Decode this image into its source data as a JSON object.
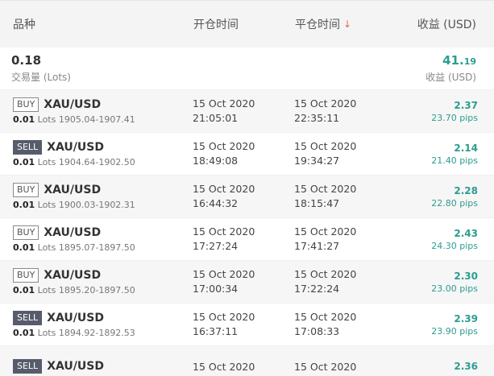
{
  "header": {
    "instrument": "品种",
    "open_time": "开仓时间",
    "close_time": "平仓时间",
    "sort_arrow": "↓",
    "profit": "收益 (USD)"
  },
  "summary": {
    "lots_value": "0.18",
    "lots_label": "交易量 (Lots)",
    "profit_main": "41.",
    "profit_dec": "19",
    "profit_label": "收益 (USD)"
  },
  "trades": [
    {
      "side": "BUY",
      "symbol": "XAU/USD",
      "lots": "0.01",
      "lots_label": "Lots",
      "range": "1905.04-1907.41",
      "open_date": "15 Oct 2020",
      "open_time": "21:05:01",
      "close_date": "15 Oct 2020",
      "close_time": "22:35:11",
      "profit": "2.37",
      "pips": "23.70 pips"
    },
    {
      "side": "SELL",
      "symbol": "XAU/USD",
      "lots": "0.01",
      "lots_label": "Lots",
      "range": "1904.64-1902.50",
      "open_date": "15 Oct 2020",
      "open_time": "18:49:08",
      "close_date": "15 Oct 2020",
      "close_time": "19:34:27",
      "profit": "2.14",
      "pips": "21.40 pips"
    },
    {
      "side": "BUY",
      "symbol": "XAU/USD",
      "lots": "0.01",
      "lots_label": "Lots",
      "range": "1900.03-1902.31",
      "open_date": "15 Oct 2020",
      "open_time": "16:44:32",
      "close_date": "15 Oct 2020",
      "close_time": "18:15:47",
      "profit": "2.28",
      "pips": "22.80 pips"
    },
    {
      "side": "BUY",
      "symbol": "XAU/USD",
      "lots": "0.01",
      "lots_label": "Lots",
      "range": "1895.07-1897.50",
      "open_date": "15 Oct 2020",
      "open_time": "17:27:24",
      "close_date": "15 Oct 2020",
      "close_time": "17:41:27",
      "profit": "2.43",
      "pips": "24.30 pips"
    },
    {
      "side": "BUY",
      "symbol": "XAU/USD",
      "lots": "0.01",
      "lots_label": "Lots",
      "range": "1895.20-1897.50",
      "open_date": "15 Oct 2020",
      "open_time": "17:00:34",
      "close_date": "15 Oct 2020",
      "close_time": "17:22:24",
      "profit": "2.30",
      "pips": "23.00 pips"
    },
    {
      "side": "SELL",
      "symbol": "XAU/USD",
      "lots": "0.01",
      "lots_label": "Lots",
      "range": "1894.92-1892.53",
      "open_date": "15 Oct 2020",
      "open_time": "16:37:11",
      "close_date": "15 Oct 2020",
      "close_time": "17:08:33",
      "profit": "2.39",
      "pips": "23.90 pips"
    },
    {
      "side": "SELL",
      "symbol": "XAU/USD",
      "lots": "",
      "lots_label": "",
      "range": "",
      "open_date": "15 Oct 2020",
      "open_time": "",
      "close_date": "15 Oct 2020",
      "close_time": "",
      "profit": "2.36",
      "pips": ""
    }
  ],
  "colors": {
    "profit": "#2a9d8f",
    "sort_arrow": "#e8644a",
    "sell_badge": "#565c6a"
  }
}
